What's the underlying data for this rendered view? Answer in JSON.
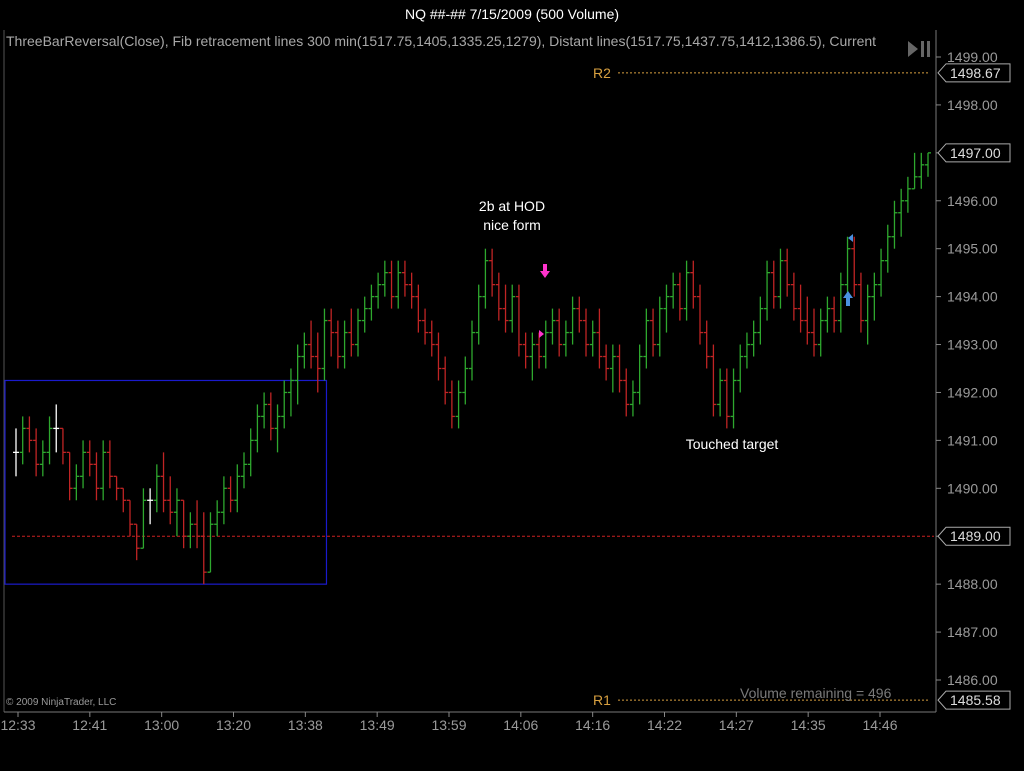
{
  "window": {
    "title": "NQ ##-##  7/15/2009 (500 Volume)"
  },
  "indicator_text": "ThreeBarReversal(Close), Fib retracement lines 300 min(1517.75,1405,1335.25,1279), Distant lines(1517.75,1437.75,1412,1386.5), Current",
  "copyright": "© 2009 NinjaTrader, LLC",
  "volume_remaining": "Volume remaining = 496",
  "annotations": {
    "hod": [
      "2b at HOD",
      "nice form"
    ],
    "target": "Touched target"
  },
  "colors": {
    "background": "#000000",
    "up_bar": "#2ea82e",
    "down_bar": "#c02424",
    "neutral_bar": "#ffffff",
    "box": "#1a1acc",
    "pivot_line": "#d8a040",
    "red_line": "#cc2020",
    "axis_text": "#9a9a9a",
    "signal_down": "#ff33cc",
    "signal_up": "#4a90e0"
  },
  "icons": {
    "playback": "play-pause-icon",
    "down_signal": "down-arrow-icon",
    "up_signal": "up-arrow-icon"
  },
  "chart_data": {
    "type": "ohlc",
    "instrument": "NQ ##-##",
    "ylim": [
      1485.5,
      1499.25
    ],
    "y_ticks": [
      "1499.00",
      "1498.00",
      "1497.00",
      "1496.00",
      "1495.00",
      "1494.00",
      "1493.00",
      "1492.00",
      "1491.00",
      "1490.00",
      "1489.00",
      "1488.00",
      "1487.00",
      "1486.00"
    ],
    "x_ticks": [
      "12:33",
      "12:41",
      "13:00",
      "13:20",
      "13:38",
      "13:49",
      "13:59",
      "14:06",
      "14:16",
      "14:22",
      "14:27",
      "14:35",
      "14:46"
    ],
    "price_tags": [
      {
        "label": "R2",
        "value": 1498.67,
        "text": "1498.67"
      },
      {
        "label": "",
        "value": 1497.0,
        "text": "1497.00"
      },
      {
        "label": "",
        "value": 1489.0,
        "text": "1489.00"
      },
      {
        "label": "R1",
        "value": 1485.58,
        "text": "1485.58"
      }
    ],
    "pivot_lines": [
      {
        "label": "R2",
        "value": 1498.67
      },
      {
        "label": "R1",
        "value": 1485.58
      }
    ],
    "red_line_value": 1489.0,
    "box": {
      "x_from": 0,
      "x_to": 46,
      "y_high": 1492.25,
      "y_low": 1488.0
    },
    "bars": [
      [
        1490.75,
        1491.25,
        1490.25,
        1490.75
      ],
      [
        1490.75,
        1491.5,
        1490.5,
        1491.25
      ],
      [
        1491.25,
        1491.5,
        1490.75,
        1491.0
      ],
      [
        1491.0,
        1491.25,
        1490.25,
        1490.5
      ],
      [
        1490.5,
        1491.0,
        1490.25,
        1490.75
      ],
      [
        1490.75,
        1491.5,
        1490.5,
        1491.25
      ],
      [
        1491.25,
        1491.75,
        1490.75,
        1491.25
      ],
      [
        1491.25,
        1491.25,
        1490.5,
        1490.75
      ],
      [
        1490.75,
        1490.75,
        1489.75,
        1490.0
      ],
      [
        1490.0,
        1490.5,
        1489.75,
        1490.25
      ],
      [
        1490.25,
        1491.0,
        1490.0,
        1490.75
      ],
      [
        1490.75,
        1491.0,
        1490.25,
        1490.5
      ],
      [
        1490.5,
        1490.75,
        1489.75,
        1490.0
      ],
      [
        1490.0,
        1491.0,
        1489.75,
        1490.75
      ],
      [
        1490.75,
        1491.0,
        1490.0,
        1490.25
      ],
      [
        1490.25,
        1490.25,
        1489.75,
        1490.0
      ],
      [
        1490.0,
        1490.0,
        1489.5,
        1489.75
      ],
      [
        1489.75,
        1489.75,
        1489.0,
        1489.25
      ],
      [
        1489.25,
        1489.25,
        1488.5,
        1488.75
      ],
      [
        1488.75,
        1490.0,
        1488.75,
        1489.75
      ],
      [
        1489.75,
        1490.0,
        1489.25,
        1489.75
      ],
      [
        1489.75,
        1490.5,
        1489.5,
        1490.25
      ],
      [
        1490.25,
        1490.75,
        1489.5,
        1489.75
      ],
      [
        1489.75,
        1490.25,
        1489.25,
        1489.5
      ],
      [
        1489.5,
        1490.0,
        1489.0,
        1489.75
      ],
      [
        1489.75,
        1489.75,
        1488.75,
        1489.0
      ],
      [
        1489.0,
        1489.5,
        1488.75,
        1489.25
      ],
      [
        1489.25,
        1489.75,
        1488.75,
        1489.0
      ],
      [
        1489.0,
        1489.5,
        1488.0,
        1488.25
      ],
      [
        1488.25,
        1489.5,
        1488.25,
        1489.25
      ],
      [
        1489.25,
        1489.75,
        1489.0,
        1489.5
      ],
      [
        1489.5,
        1490.25,
        1489.25,
        1490.0
      ],
      [
        1490.0,
        1490.25,
        1489.5,
        1489.75
      ],
      [
        1489.75,
        1490.5,
        1489.5,
        1490.25
      ],
      [
        1490.25,
        1490.75,
        1490.0,
        1490.5
      ],
      [
        1490.5,
        1491.25,
        1490.25,
        1491.0
      ],
      [
        1491.0,
        1491.75,
        1490.75,
        1491.5
      ],
      [
        1491.5,
        1492.0,
        1491.25,
        1491.75
      ],
      [
        1491.75,
        1492.0,
        1491.0,
        1491.25
      ],
      [
        1491.25,
        1491.75,
        1490.75,
        1491.5
      ],
      [
        1491.5,
        1492.25,
        1491.25,
        1492.0
      ],
      [
        1492.0,
        1492.5,
        1491.5,
        1492.25
      ],
      [
        1492.25,
        1493.0,
        1491.75,
        1492.75
      ],
      [
        1492.75,
        1493.25,
        1492.5,
        1493.0
      ],
      [
        1493.0,
        1493.5,
        1492.5,
        1492.75
      ],
      [
        1492.75,
        1493.25,
        1492.0,
        1492.5
      ],
      [
        1492.5,
        1493.75,
        1492.25,
        1493.5
      ],
      [
        1493.5,
        1493.75,
        1492.75,
        1493.25
      ],
      [
        1493.25,
        1493.5,
        1492.5,
        1492.75
      ],
      [
        1492.75,
        1493.5,
        1492.5,
        1493.25
      ],
      [
        1493.25,
        1493.75,
        1492.75,
        1493.0
      ],
      [
        1493.0,
        1493.75,
        1492.75,
        1493.5
      ],
      [
        1493.5,
        1494.0,
        1493.25,
        1493.75
      ],
      [
        1493.75,
        1494.25,
        1493.5,
        1494.0
      ],
      [
        1494.0,
        1494.5,
        1493.75,
        1494.25
      ],
      [
        1494.25,
        1494.75,
        1494.0,
        1494.5
      ],
      [
        1494.5,
        1494.75,
        1493.75,
        1494.0
      ],
      [
        1494.0,
        1494.75,
        1493.75,
        1494.5
      ],
      [
        1494.5,
        1494.75,
        1494.0,
        1494.25
      ],
      [
        1494.25,
        1494.5,
        1493.75,
        1494.0
      ],
      [
        1494.0,
        1494.25,
        1493.25,
        1493.5
      ],
      [
        1493.5,
        1493.75,
        1493.0,
        1493.25
      ],
      [
        1493.25,
        1493.5,
        1492.75,
        1493.0
      ],
      [
        1493.0,
        1493.25,
        1492.25,
        1492.5
      ],
      [
        1492.5,
        1492.75,
        1491.75,
        1492.0
      ],
      [
        1492.0,
        1492.25,
        1491.25,
        1491.5
      ],
      [
        1491.5,
        1492.25,
        1491.25,
        1492.0
      ],
      [
        1492.0,
        1492.75,
        1491.75,
        1492.5
      ],
      [
        1492.5,
        1493.5,
        1492.25,
        1493.25
      ],
      [
        1493.25,
        1494.25,
        1493.0,
        1494.0
      ],
      [
        1494.0,
        1495.0,
        1493.75,
        1494.75
      ],
      [
        1494.75,
        1495.0,
        1494.0,
        1494.25
      ],
      [
        1494.25,
        1494.5,
        1493.5,
        1493.75
      ],
      [
        1493.75,
        1494.25,
        1493.25,
        1493.5
      ],
      [
        1493.5,
        1494.25,
        1493.25,
        1494.0
      ],
      [
        1494.0,
        1494.25,
        1492.75,
        1493.0
      ],
      [
        1493.0,
        1493.25,
        1492.5,
        1492.75
      ],
      [
        1492.75,
        1493.25,
        1492.25,
        1493.0
      ],
      [
        1493.0,
        1493.25,
        1492.5,
        1492.75
      ],
      [
        1492.75,
        1493.5,
        1492.5,
        1493.25
      ],
      [
        1493.25,
        1493.75,
        1493.0,
        1493.5
      ],
      [
        1493.5,
        1493.75,
        1492.75,
        1493.0
      ],
      [
        1493.0,
        1493.5,
        1492.75,
        1493.25
      ],
      [
        1493.25,
        1494.0,
        1493.0,
        1493.75
      ],
      [
        1493.75,
        1494.0,
        1493.25,
        1493.5
      ],
      [
        1493.5,
        1493.75,
        1492.75,
        1493.0
      ],
      [
        1493.0,
        1493.5,
        1492.75,
        1493.25
      ],
      [
        1493.25,
        1493.75,
        1492.5,
        1492.75
      ],
      [
        1492.75,
        1493.0,
        1492.25,
        1492.5
      ],
      [
        1492.5,
        1493.0,
        1492.0,
        1492.75
      ],
      [
        1492.75,
        1493.0,
        1492.0,
        1492.25
      ],
      [
        1492.25,
        1492.5,
        1491.5,
        1491.75
      ],
      [
        1491.75,
        1492.25,
        1491.5,
        1492.0
      ],
      [
        1492.0,
        1493.0,
        1491.75,
        1492.75
      ],
      [
        1492.75,
        1493.75,
        1492.5,
        1493.5
      ],
      [
        1493.5,
        1493.75,
        1492.75,
        1493.0
      ],
      [
        1493.0,
        1494.0,
        1492.75,
        1493.75
      ],
      [
        1493.75,
        1494.25,
        1493.25,
        1494.0
      ],
      [
        1494.0,
        1494.5,
        1493.75,
        1494.25
      ],
      [
        1494.25,
        1494.5,
        1493.5,
        1493.75
      ],
      [
        1493.75,
        1494.75,
        1493.5,
        1494.5
      ],
      [
        1494.5,
        1494.75,
        1493.75,
        1494.0
      ],
      [
        1494.0,
        1494.25,
        1493.0,
        1493.25
      ],
      [
        1493.25,
        1493.5,
        1492.5,
        1492.75
      ],
      [
        1492.75,
        1493.0,
        1491.5,
        1491.75
      ],
      [
        1491.75,
        1492.5,
        1491.5,
        1492.25
      ],
      [
        1492.25,
        1492.5,
        1491.25,
        1491.5
      ],
      [
        1491.5,
        1492.5,
        1491.25,
        1492.25
      ],
      [
        1492.25,
        1493.0,
        1492.0,
        1492.75
      ],
      [
        1492.75,
        1493.25,
        1492.5,
        1493.0
      ],
      [
        1493.0,
        1493.5,
        1492.75,
        1493.25
      ],
      [
        1493.25,
        1494.0,
        1493.0,
        1493.75
      ],
      [
        1493.75,
        1494.75,
        1493.5,
        1494.5
      ],
      [
        1494.5,
        1494.75,
        1493.75,
        1494.0
      ],
      [
        1494.0,
        1495.0,
        1493.75,
        1494.75
      ],
      [
        1494.75,
        1495.0,
        1494.0,
        1494.25
      ],
      [
        1494.25,
        1494.5,
        1493.5,
        1493.75
      ],
      [
        1493.75,
        1494.25,
        1493.25,
        1493.5
      ],
      [
        1493.5,
        1494.0,
        1493.0,
        1493.25
      ],
      [
        1493.25,
        1493.75,
        1492.75,
        1493.0
      ],
      [
        1493.0,
        1493.75,
        1492.75,
        1493.5
      ],
      [
        1493.5,
        1494.0,
        1493.25,
        1493.75
      ],
      [
        1493.75,
        1494.0,
        1493.25,
        1493.5
      ],
      [
        1493.5,
        1494.5,
        1493.25,
        1494.25
      ],
      [
        1494.25,
        1495.25,
        1494.0,
        1495.0
      ],
      [
        1495.0,
        1495.25,
        1494.0,
        1494.25
      ],
      [
        1494.25,
        1494.5,
        1493.25,
        1493.5
      ],
      [
        1493.5,
        1494.25,
        1493.0,
        1494.0
      ],
      [
        1494.0,
        1494.5,
        1493.5,
        1494.25
      ],
      [
        1494.25,
        1495.0,
        1494.0,
        1494.75
      ],
      [
        1494.75,
        1495.5,
        1494.5,
        1495.25
      ],
      [
        1495.25,
        1496.0,
        1495.0,
        1495.75
      ],
      [
        1495.75,
        1496.25,
        1495.25,
        1496.0
      ],
      [
        1496.0,
        1496.5,
        1495.75,
        1496.25
      ],
      [
        1496.25,
        1497.0,
        1496.25,
        1496.5
      ],
      [
        1496.5,
        1497.0,
        1496.25,
        1496.75
      ],
      [
        1496.75,
        1497.0,
        1496.5,
        1497.0
      ]
    ]
  }
}
